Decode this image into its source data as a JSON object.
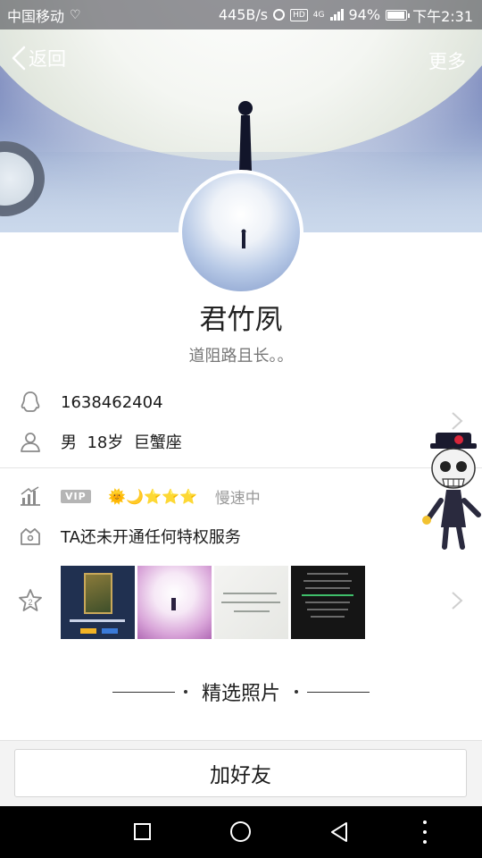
{
  "status_bar": {
    "carrier": "中国移动",
    "speed": "445B/s",
    "network": "4G",
    "battery": "94%",
    "time": "下午2:31"
  },
  "nav": {
    "back_label": "返回",
    "more_label": "更多"
  },
  "profile": {
    "name": "君竹夙",
    "signature": "道阻路且长。。"
  },
  "info": {
    "qq_number": "1638462404",
    "gender_age_sign": "男  18岁  巨蟹座"
  },
  "vip": {
    "badge": "VIP",
    "level_icons": "🌞🌙⭐⭐⭐",
    "speed_status": "慢速中"
  },
  "privilege": {
    "text": "TA还未开通任何特权服务"
  },
  "featured": {
    "title": "精选照片"
  },
  "actions": {
    "add_friend": "加好友"
  },
  "colors": {
    "accent_text": "#222222",
    "muted_text": "#777777",
    "vip_gray": "#b5b5b5",
    "star_gold": "#f5b400"
  },
  "icons": {
    "qq": "qq-penguin-icon",
    "person": "person-icon",
    "level": "level-chart-icon",
    "privilege": "crown-box-icon",
    "photo_star": "star-icon"
  }
}
